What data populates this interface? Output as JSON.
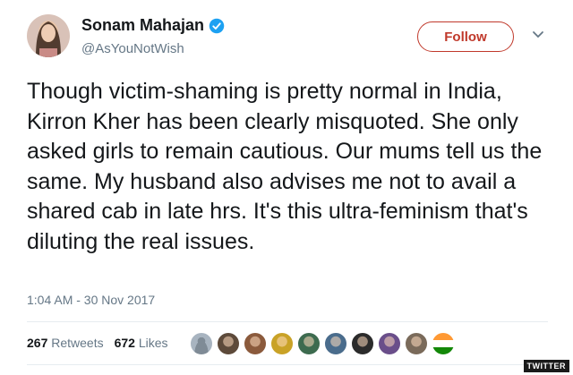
{
  "user": {
    "name": "Sonam Mahajan",
    "handle": "@AsYouNotWish",
    "verified": true
  },
  "actions": {
    "follow_label": "Follow"
  },
  "tweet": {
    "text": "Though victim-shaming is pretty normal in India, Kirron Kher has been clearly misquoted. She only asked girls to remain cautious. Our mums tell us the same. My husband also advises me not to avail a shared cab in late hrs. It's this ultra-feminism that's diluting the real issues.",
    "timestamp": "1:04 AM - 30 Nov 2017"
  },
  "stats": {
    "retweets_count": "267",
    "retweets_label": "Retweets",
    "likes_count": "672",
    "likes_label": "Likes"
  },
  "likers": [
    {
      "icon": "default-avatar-icon",
      "color": "#a8b4c0"
    },
    {
      "icon": "user-avatar-icon",
      "color": "#5d4a3a"
    },
    {
      "icon": "user-avatar-icon",
      "color": "#8b5a3c"
    },
    {
      "icon": "user-avatar-icon",
      "color": "#c9a227"
    },
    {
      "icon": "user-avatar-icon",
      "color": "#3d6b4f"
    },
    {
      "icon": "user-avatar-icon",
      "color": "#4a6c8c"
    },
    {
      "icon": "user-avatar-icon",
      "color": "#2b2b2b"
    },
    {
      "icon": "user-avatar-icon",
      "color": "#6a4e8a"
    },
    {
      "icon": "user-avatar-icon",
      "color": "#7a6a5a"
    },
    {
      "icon": "flag-avatar-icon",
      "color": "#ff9933"
    }
  ],
  "brand_label": "TWITTER",
  "colors": {
    "accent": "#c0392b",
    "verified": "#1da1f2",
    "secondary_text": "#657786"
  }
}
